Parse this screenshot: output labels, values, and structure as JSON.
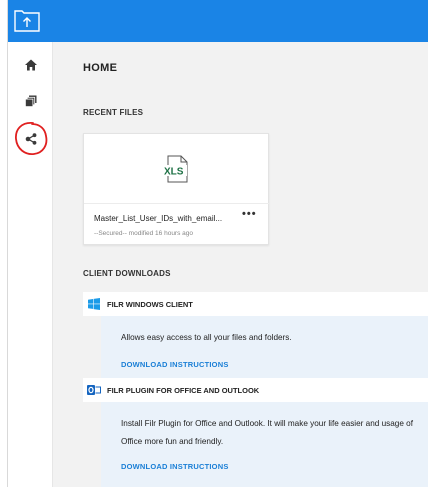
{
  "colors": {
    "topbar": "#1a84e6",
    "link": "#1a7fd6",
    "annotation": "#e02020",
    "xls_green": "#1e7145"
  },
  "icons": {
    "brand": "upload-folder-icon",
    "home": "home-icon",
    "files": "documents-icon",
    "share": "share-icon",
    "file": "xls-file-icon",
    "windows": "windows-icon",
    "office": "outlook-icon"
  },
  "main": {
    "title": "HOME",
    "recent_files": {
      "label": "RECENT FILES",
      "items": [
        {
          "name": "Master_List_User_IDs_with_email...",
          "meta": "--Secured-- modified 16 hours ago",
          "type_badge": "XLS",
          "menu": "•••"
        }
      ]
    },
    "client_downloads": {
      "label": "CLIENT DOWNLOADS",
      "items": [
        {
          "title": "FILR WINDOWS CLIENT",
          "description": "Allows easy access to all your files and folders.",
          "link": "DOWNLOAD INSTRUCTIONS"
        },
        {
          "title": "FILR PLUGIN FOR OFFICE AND OUTLOOK",
          "description": "Install Filr Plugin for Office and Outlook. It will make your life easier and usage of Office more fun and friendly.",
          "link": "DOWNLOAD INSTRUCTIONS"
        }
      ]
    }
  }
}
